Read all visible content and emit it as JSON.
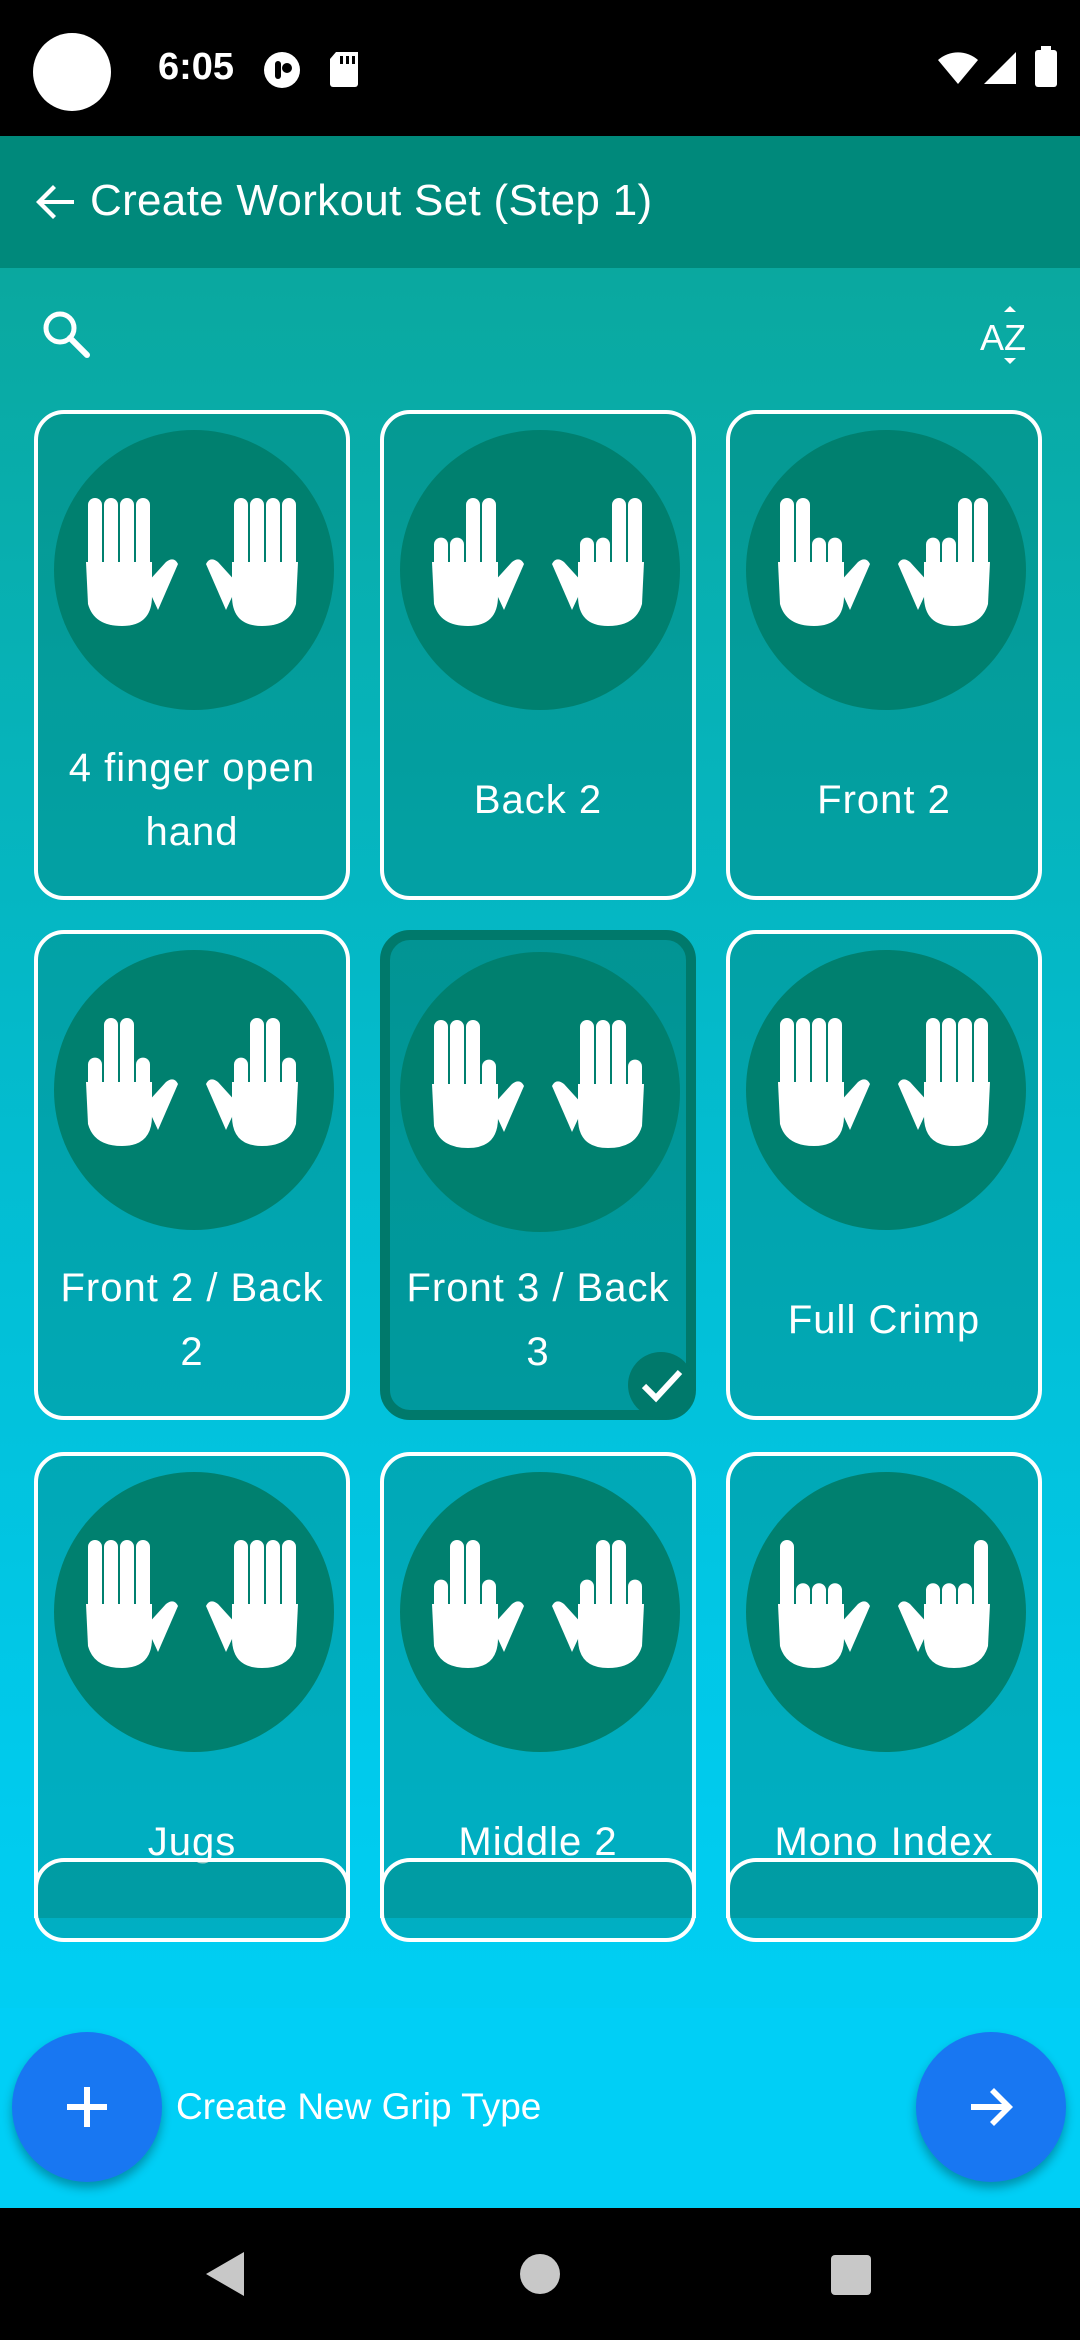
{
  "status_bar": {
    "time": "6:05"
  },
  "app_bar": {
    "title": "Create Workout Set (Step 1)"
  },
  "toolbar": {
    "sort_label": "AZ"
  },
  "grips": [
    {
      "label": "4 finger open hand",
      "left": "four-up-open",
      "right": "four-up-open",
      "selected": false
    },
    {
      "label": "Back 2",
      "left": "back2-left",
      "right": "back2-right",
      "selected": false
    },
    {
      "label": "Front 2",
      "left": "front2-left",
      "right": "front2-right",
      "selected": false
    },
    {
      "label": "Front 2 / Back 2",
      "left": "front2back2",
      "right": "front2back2",
      "selected": false
    },
    {
      "label": "Front 3 / Back 3",
      "left": "front3",
      "right": "back3",
      "selected": true
    },
    {
      "label": "Full Crimp",
      "left": "four-up-open",
      "right": "four-up-open",
      "selected": false
    },
    {
      "label": "Jugs",
      "left": "four-up-open",
      "right": "four-up-open",
      "selected": false
    },
    {
      "label": "Middle 2",
      "left": "middle2",
      "right": "middle2",
      "selected": false
    },
    {
      "label": "Mono Index",
      "left": "mono",
      "right": "mono",
      "selected": false
    }
  ],
  "bottom": {
    "create_label": "Create New Grip Type"
  },
  "colors": {
    "app_bar": "#00897b",
    "fab": "#1877f2",
    "circle": "#00806f"
  }
}
